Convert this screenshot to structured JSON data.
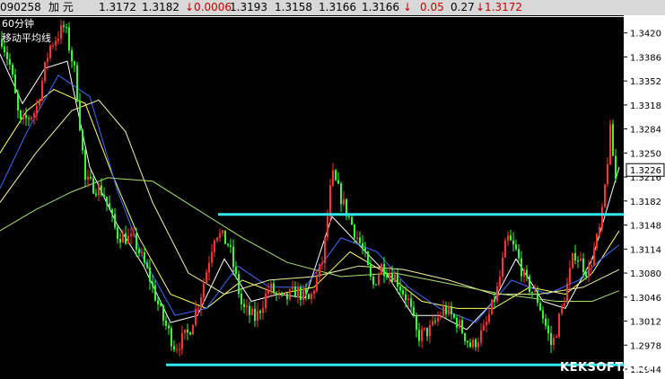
{
  "quote": {
    "code": "090258",
    "name": "加 元",
    "open": "1.3172",
    "prev": "1.3182",
    "change": "↓0.0006",
    "high": "1.3193",
    "low": "1.3158",
    "bid": "1.3166",
    "ask": "1.3166",
    "arrow": "↓",
    "pct": "0.05",
    "amp": "0.27",
    "last": "↓1.3172"
  },
  "overlay": {
    "period": "60分钟",
    "indicator": "移动平均线",
    "watermark": "KEKSOFT.COM"
  },
  "chart_data": {
    "type": "candlestick",
    "ylim": [
      1.293,
      1.3445
    ],
    "yticks": [
      "1.3420",
      "1.3386",
      "1.3352",
      "1.3318",
      "1.3284",
      "1.3250",
      "1.3216",
      "1.3182",
      "1.3148",
      "1.3114",
      "1.3080",
      "1.3046",
      "1.3012",
      "1.2978",
      "1.2944"
    ],
    "current_price_label": "1.3226",
    "current_price": 1.3226,
    "colors": {
      "up": "#ff3030",
      "down": "#30ff30",
      "ma_white": "#ffffff",
      "ma_yellow": "#ffff60",
      "ma_blue": "#3a6cff",
      "ma_lightyellow": "#f0f0a0",
      "ma_green": "#a8e070",
      "trend_line": "#30e8f0"
    },
    "path": [
      [
        0,
        1.342
      ],
      [
        12,
        1.337
      ],
      [
        22,
        1.329
      ],
      [
        40,
        1.331
      ],
      [
        55,
        1.34
      ],
      [
        72,
        1.343
      ],
      [
        84,
        1.336
      ],
      [
        95,
        1.321
      ],
      [
        115,
        1.3195
      ],
      [
        130,
        1.3135
      ],
      [
        150,
        1.3125
      ],
      [
        165,
        1.308
      ],
      [
        180,
        1.302
      ],
      [
        195,
        1.2975
      ],
      [
        210,
        1.2995
      ],
      [
        225,
        1.3055
      ],
      [
        240,
        1.314
      ],
      [
        255,
        1.312
      ],
      [
        270,
        1.303
      ],
      [
        285,
        1.3015
      ],
      [
        300,
        1.306
      ],
      [
        315,
        1.304
      ],
      [
        330,
        1.3055
      ],
      [
        345,
        1.304
      ],
      [
        360,
        1.31
      ],
      [
        370,
        1.322
      ],
      [
        385,
        1.317
      ],
      [
        395,
        1.314
      ],
      [
        405,
        1.311
      ],
      [
        415,
        1.306
      ],
      [
        425,
        1.309
      ],
      [
        440,
        1.3075
      ],
      [
        455,
        1.304
      ],
      [
        465,
        1.299
      ],
      [
        480,
        1.3
      ],
      [
        495,
        1.303
      ],
      [
        510,
        1.301
      ],
      [
        525,
        1.2975
      ],
      [
        540,
        1.3
      ],
      [
        555,
        1.306
      ],
      [
        565,
        1.313
      ],
      [
        575,
        1.311
      ],
      [
        585,
        1.307
      ],
      [
        600,
        1.304
      ],
      [
        615,
        1.2975
      ],
      [
        630,
        1.305
      ],
      [
        640,
        1.311
      ],
      [
        655,
        1.308
      ],
      [
        670,
        1.315
      ],
      [
        680,
        1.328
      ],
      [
        688,
        1.319
      ]
    ],
    "moving_averages": [
      {
        "color": "ma_white",
        "points": [
          [
            0,
            1.339
          ],
          [
            25,
            1.332
          ],
          [
            50,
            1.337
          ],
          [
            75,
            1.338
          ],
          [
            100,
            1.323
          ],
          [
            130,
            1.315
          ],
          [
            160,
            1.309
          ],
          [
            190,
            1.301
          ],
          [
            220,
            1.302
          ],
          [
            250,
            1.31
          ],
          [
            280,
            1.304
          ],
          [
            310,
            1.305
          ],
          [
            340,
            1.3045
          ],
          [
            370,
            1.316
          ],
          [
            400,
            1.312
          ],
          [
            430,
            1.308
          ],
          [
            460,
            1.302
          ],
          [
            490,
            1.302
          ],
          [
            520,
            1.3
          ],
          [
            550,
            1.304
          ],
          [
            575,
            1.31
          ],
          [
            605,
            1.304
          ],
          [
            630,
            1.303
          ],
          [
            660,
            1.31
          ],
          [
            690,
            1.323
          ]
        ]
      },
      {
        "color": "ma_yellow",
        "points": [
          [
            0,
            1.325
          ],
          [
            30,
            1.331
          ],
          [
            60,
            1.334
          ],
          [
            95,
            1.332
          ],
          [
            125,
            1.322
          ],
          [
            155,
            1.313
          ],
          [
            190,
            1.305
          ],
          [
            230,
            1.303
          ],
          [
            270,
            1.307
          ],
          [
            310,
            1.305
          ],
          [
            350,
            1.306
          ],
          [
            390,
            1.311
          ],
          [
            430,
            1.308
          ],
          [
            470,
            1.304
          ],
          [
            510,
            1.303
          ],
          [
            550,
            1.303
          ],
          [
            590,
            1.306
          ],
          [
            630,
            1.305
          ],
          [
            660,
            1.308
          ],
          [
            690,
            1.314
          ]
        ]
      },
      {
        "color": "ma_blue",
        "points": [
          [
            0,
            1.32
          ],
          [
            30,
            1.328
          ],
          [
            65,
            1.336
          ],
          [
            100,
            1.333
          ],
          [
            130,
            1.32
          ],
          [
            160,
            1.31
          ],
          [
            195,
            1.302
          ],
          [
            230,
            1.303
          ],
          [
            265,
            1.309
          ],
          [
            300,
            1.306
          ],
          [
            340,
            1.306
          ],
          [
            380,
            1.313
          ],
          [
            420,
            1.311
          ],
          [
            455,
            1.306
          ],
          [
            490,
            1.303
          ],
          [
            530,
            1.301
          ],
          [
            570,
            1.307
          ],
          [
            610,
            1.305
          ],
          [
            645,
            1.307
          ],
          [
            670,
            1.31
          ],
          [
            690,
            1.312
          ]
        ]
      },
      {
        "color": "ma_lightyellow",
        "points": [
          [
            0,
            1.318
          ],
          [
            40,
            1.325
          ],
          [
            80,
            1.331
          ],
          [
            110,
            1.3325
          ],
          [
            140,
            1.328
          ],
          [
            170,
            1.318
          ],
          [
            210,
            1.308
          ],
          [
            250,
            1.305
          ],
          [
            300,
            1.307
          ],
          [
            350,
            1.3075
          ],
          [
            400,
            1.309
          ],
          [
            450,
            1.3085
          ],
          [
            500,
            1.307
          ],
          [
            550,
            1.305
          ],
          [
            600,
            1.305
          ],
          [
            650,
            1.306
          ],
          [
            690,
            1.3085
          ]
        ]
      },
      {
        "color": "ma_green",
        "points": [
          [
            0,
            1.314
          ],
          [
            40,
            1.317
          ],
          [
            80,
            1.3195
          ],
          [
            120,
            1.3215
          ],
          [
            170,
            1.321
          ],
          [
            220,
            1.317
          ],
          [
            270,
            1.313
          ],
          [
            320,
            1.3095
          ],
          [
            380,
            1.3075
          ],
          [
            440,
            1.308
          ],
          [
            500,
            1.3065
          ],
          [
            560,
            1.305
          ],
          [
            620,
            1.304
          ],
          [
            660,
            1.304
          ],
          [
            690,
            1.3055
          ]
        ]
      }
    ],
    "trend_lines": [
      {
        "x1": 243,
        "x2": 715,
        "y": 1.3163
      },
      {
        "x1": 185,
        "x2": 713,
        "y": 1.295
      }
    ]
  }
}
